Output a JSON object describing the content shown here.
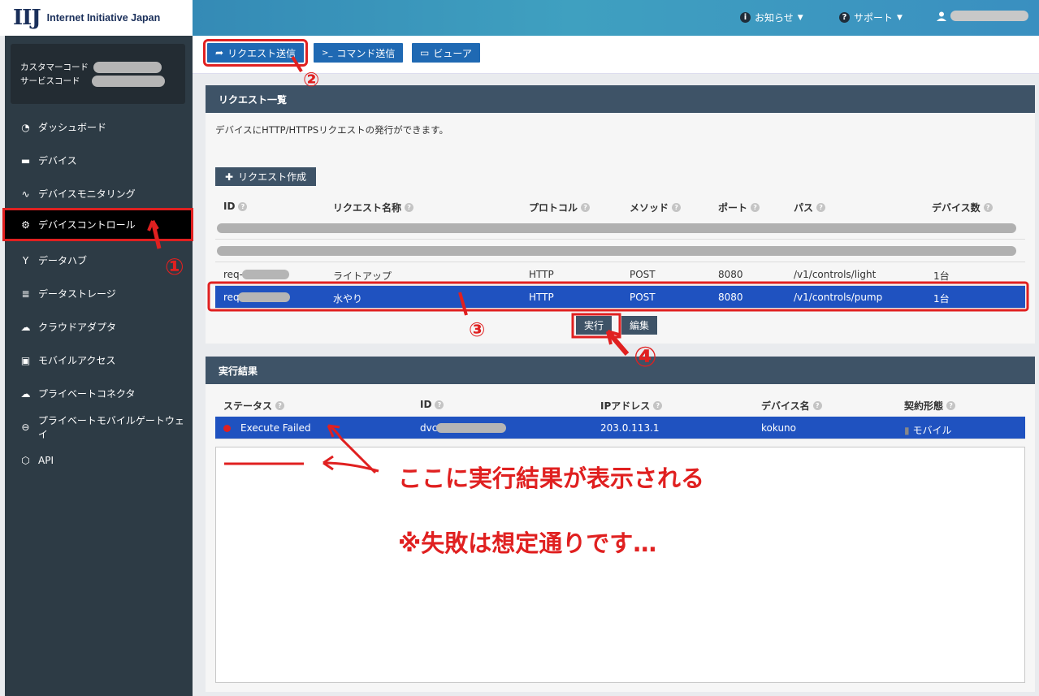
{
  "header": {
    "logo_mark": "IIJ",
    "logo_text": "Internet Initiative Japan",
    "notice": "お知らせ",
    "support": "サポート",
    "notice_icon": "info-icon",
    "support_icon": "question-icon",
    "user_icon": "user-icon"
  },
  "sidebar": {
    "customer_code_label": "カスタマーコード",
    "service_code_label": "サービスコード",
    "items": [
      {
        "label": "ダッシュボード",
        "icon": "dashboard-icon"
      },
      {
        "label": "デバイス",
        "icon": "device-icon"
      },
      {
        "label": "デバイスモニタリング",
        "icon": "pulse-icon"
      },
      {
        "label": "デバイスコントロール",
        "icon": "gear-icon"
      },
      {
        "label": "データハブ",
        "icon": "hub-icon"
      },
      {
        "label": "データストレージ",
        "icon": "database-icon"
      },
      {
        "label": "クラウドアダプタ",
        "icon": "cloud-icon"
      },
      {
        "label": "モバイルアクセス",
        "icon": "sim-icon"
      },
      {
        "label": "プライベートコネクタ",
        "icon": "cloud-connector-icon"
      },
      {
        "label": "プライベートモバイルゲートウェイ",
        "icon": "gateway-icon"
      },
      {
        "label": "API",
        "icon": "api-icon"
      }
    ]
  },
  "toolbar": {
    "request_send": "リクエスト送信",
    "command_send": "コマンド送信",
    "viewer": "ビューア"
  },
  "request_panel": {
    "title": "リクエスト一覧",
    "description": "デバイスにHTTP/HTTPSリクエストの発行ができます。",
    "create_button": "リクエスト作成",
    "columns": [
      "ID",
      "リクエスト名称",
      "プロトコル",
      "メソッド",
      "ポート",
      "パス",
      "デバイス数"
    ],
    "rows": [
      {
        "id": "req-",
        "name": "ライトアップ",
        "protocol": "HTTP",
        "method": "POST",
        "port": "8080",
        "path": "/v1/controls/light",
        "devices": "1台"
      },
      {
        "id": "req",
        "name": "水やり",
        "protocol": "HTTP",
        "method": "POST",
        "port": "8080",
        "path": "/v1/controls/pump",
        "devices": "1台"
      }
    ],
    "run_button": "実行",
    "edit_button": "編集"
  },
  "result_panel": {
    "title": "実行結果",
    "columns": [
      "ステータス",
      "ID",
      "IPアドレス",
      "デバイス名",
      "契約形態"
    ],
    "row": {
      "status": "Execute Failed",
      "id": "dvc",
      "ip": "203.0.113.1",
      "device_name": "kokuno",
      "contract": "モバイル"
    },
    "status_color": "#e02020"
  },
  "annotations": {
    "step1": "①",
    "step2": "②",
    "step3": "③",
    "step4": "④",
    "note1": "ここに実行結果が表示される",
    "note2": "※失敗は想定通りです…"
  },
  "colors": {
    "accent": "#1f69b3",
    "selected_row": "#1f52c0",
    "panel_head": "#3e5367",
    "sidebar": "#2d3b45",
    "annotation": "#e02020"
  }
}
